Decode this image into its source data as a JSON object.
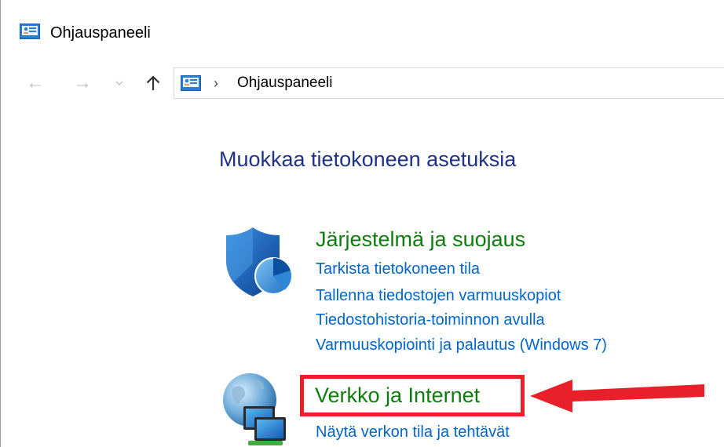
{
  "window": {
    "title": "Ohjauspaneeli"
  },
  "navigation": {
    "back_icon": "arrow-left-icon",
    "forward_icon": "arrow-right-icon",
    "recent_icon": "chevron-down-icon",
    "up_icon": "arrow-up-icon",
    "address_separator": "›",
    "address_location": "Ohjauspaneeli"
  },
  "main": {
    "heading": "Muokkaa tietokoneen asetuksia",
    "categories": [
      {
        "title": "Järjestelmä ja suojaus",
        "icon": "shield-icon",
        "links": [
          "Tarkista tietokoneen tila",
          "Tallenna tiedostojen varmuuskopiot",
          "Tiedostohistoria-toiminnon avulla",
          "Varmuuskopiointi ja palautus (Windows 7)"
        ]
      },
      {
        "title": "Verkko ja Internet",
        "icon": "network-globe-icon",
        "links": [
          "Näytä verkon tila ja tehtävät"
        ]
      }
    ]
  },
  "annotation": {
    "highlight_color": "#e8202a",
    "arrow_color": "#e8202a"
  },
  "colors": {
    "heading": "#1e3287",
    "category_title": "#107c10",
    "link": "#0066cc"
  }
}
